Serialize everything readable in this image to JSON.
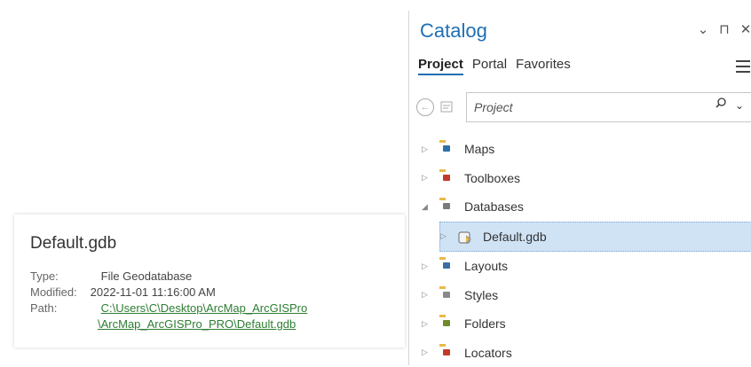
{
  "catalog": {
    "title": "Catalog",
    "tabs": [
      "Project",
      "Portal",
      "Favorites"
    ],
    "controls": [
      "⌄",
      "⊓",
      "✕"
    ],
    "search": {
      "placeholder": "Project",
      "value": "Project"
    },
    "tree": [
      {
        "label": "Maps",
        "arrow": "▷",
        "level": 0,
        "icon": "maps-folder-icon",
        "badgeColor": "#2e6fa8"
      },
      {
        "label": "Toolboxes",
        "arrow": "▷",
        "level": 0,
        "icon": "toolboxes-folder-icon",
        "badgeColor": "#c23b2a"
      },
      {
        "label": "Databases",
        "arrow": "◢",
        "level": 0,
        "icon": "databases-folder-icon",
        "badgeColor": "#7a7a7a"
      },
      {
        "label": "Default.gdb",
        "arrow": "▷",
        "level": 1,
        "icon": "geodatabase-icon",
        "selected": true
      },
      {
        "label": "Layouts",
        "arrow": "▷",
        "level": 0,
        "icon": "layouts-folder-icon",
        "badgeColor": "#3a6ea5"
      },
      {
        "label": "Styles",
        "arrow": "▷",
        "level": 0,
        "icon": "styles-folder-icon",
        "badgeColor": "#8a8a8a"
      },
      {
        "label": "Folders",
        "arrow": "▷",
        "level": 0,
        "icon": "folders-folder-icon",
        "badgeColor": "#e9b949"
      },
      {
        "label": "Locators",
        "arrow": "▷",
        "level": 0,
        "icon": "locators-folder-icon",
        "badgeColor": "#c23b2a"
      }
    ]
  },
  "info_card": {
    "title": "Default.gdb",
    "type_label": "Type:",
    "type_value": "File Geodatabase",
    "modified_label": "Modified:",
    "modified_value": "2022-11-01 11:16:00 AM",
    "path_label": "Path:",
    "path_line1": "C:\\Users\\C\\Desktop\\ArcMap_ArcGISPro",
    "path_line2": "\\ArcMap_ArcGISPro_PRO\\Default.gdb"
  },
  "colors": {
    "accent": "#1f6fb5",
    "selection": "#cfe3f5",
    "link": "#2e7d32"
  }
}
